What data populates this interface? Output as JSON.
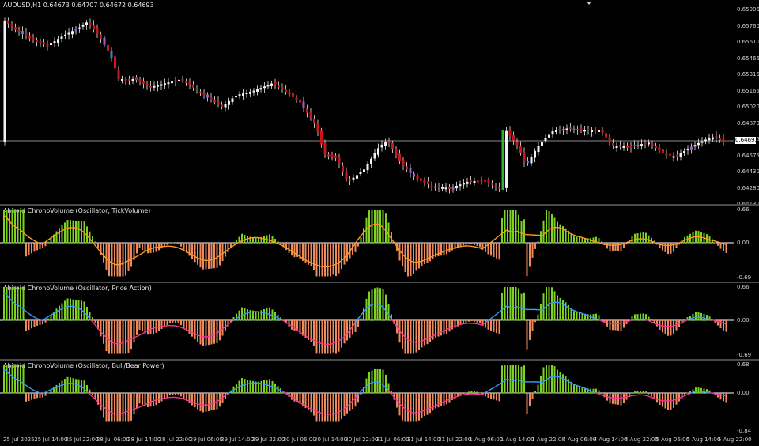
{
  "main": {
    "title": "AUDUSD,H1  0.64673 0.64707 0.64672 0.64693",
    "price_labels": [
      "0.65905",
      "0.65760",
      "0.65610",
      "0.65465",
      "0.65315",
      "0.65165",
      "0.65020",
      "0.64870",
      "0.64725",
      "0.64575",
      "0.64430",
      "0.64280",
      "0.64130"
    ],
    "current_price": "0.64693",
    "colors": {
      "bull": "#f2f2f2",
      "bear": "#c8171b",
      "purple": "#9b59d6",
      "blue": "#3b7fd9",
      "green": "#2db33a",
      "hline": "#8a8a8a"
    }
  },
  "indicators": [
    {
      "title": "Abiroid ChronoVolume (Oscillator, TickVolume)",
      "labels": [
        "0.66",
        "0.00",
        "-0.69"
      ],
      "signal_color": "#ff9a1f"
    },
    {
      "title": "Abiroid ChronoVolume (Oscillator, Price Action)",
      "labels": [
        "0.66",
        "0.00",
        "-0.69"
      ],
      "signal_colors": [
        "#2fa0ff",
        "#ff2f9a"
      ]
    },
    {
      "title": "Abiroid ChronoVolume (Oscillator, Bull/Bear Power)",
      "labels": [
        "0.68",
        "0.00",
        "-0.84"
      ],
      "signal_colors": [
        "#2fa0ff",
        "#ff2f9a"
      ]
    }
  ],
  "time_axis": [
    "25 Jul 2025",
    "25 Jul 14:00",
    "25 Jul 22:00",
    "28 Jul 06:00",
    "28 Jul 14:00",
    "28 Jul 22:00",
    "29 Jul 06:00",
    "29 Jul 14:00",
    "29 Jul 22:00",
    "30 Jul 06:00",
    "30 Jul 14:00",
    "30 Jul 22:00",
    "31 Jul 06:00",
    "31 Jul 14:00",
    "31 Jul 22:00",
    "1 Aug 06:00",
    "1 Aug 14:00",
    "1 Aug 22:00",
    "4 Aug 06:00",
    "4 Aug 14:00",
    "4 Aug 22:00",
    "5 Aug 06:00",
    "5 Aug 14:00",
    "5 Aug 22:00"
  ],
  "histogram_colors": {
    "up": "#7ed321",
    "down": "#f08a5d"
  }
}
